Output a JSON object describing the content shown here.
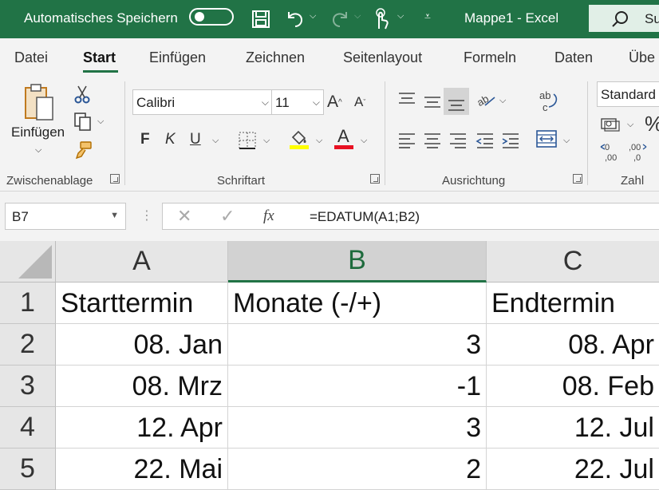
{
  "titlebar": {
    "autosave_label": "Automatisches Speichern",
    "document_title": "Mappe1  -  Excel",
    "search_label": "Su"
  },
  "menu": {
    "tabs": [
      "Datei",
      "Start",
      "Einfügen",
      "Zeichnen",
      "Seitenlayout",
      "Formeln",
      "Daten",
      "Übe"
    ],
    "active": "Start"
  },
  "ribbon": {
    "clipboard": {
      "paste_label": "Einfügen",
      "group_label": "Zwischenablage"
    },
    "font": {
      "font_name": "Calibri",
      "font_size": "11",
      "bold": "F",
      "italic": "K",
      "underline": "U",
      "font_color_glyph": "A",
      "font_color": "#e81123",
      "fill_color": "#ffff00",
      "group_label": "Schriftart"
    },
    "alignment": {
      "group_label": "Ausrichtung"
    },
    "number": {
      "format": "Standard",
      "group_label": "Zahl",
      "percent": "%"
    }
  },
  "formula_bar": {
    "name_box": "B7",
    "formula": "=EDATUM(A1;B2)",
    "fx_glyph": "fx"
  },
  "grid": {
    "columns": [
      "A",
      "B",
      "C"
    ],
    "selected_column": "B",
    "rows": [
      {
        "n": "1",
        "a": "Starttermin",
        "b": "Monate (-/+)",
        "c": "Endtermin"
      },
      {
        "n": "2",
        "a": "08. Jan",
        "b": "3",
        "c": "08. Apr"
      },
      {
        "n": "3",
        "a": "08. Mrz",
        "b": "-1",
        "c": "08. Feb"
      },
      {
        "n": "4",
        "a": "12. Apr",
        "b": "3",
        "c": "12. Jul"
      },
      {
        "n": "5",
        "a": "22. Mai",
        "b": "2",
        "c": "22. Jul"
      }
    ]
  },
  "colors": {
    "accent": "#217346"
  }
}
